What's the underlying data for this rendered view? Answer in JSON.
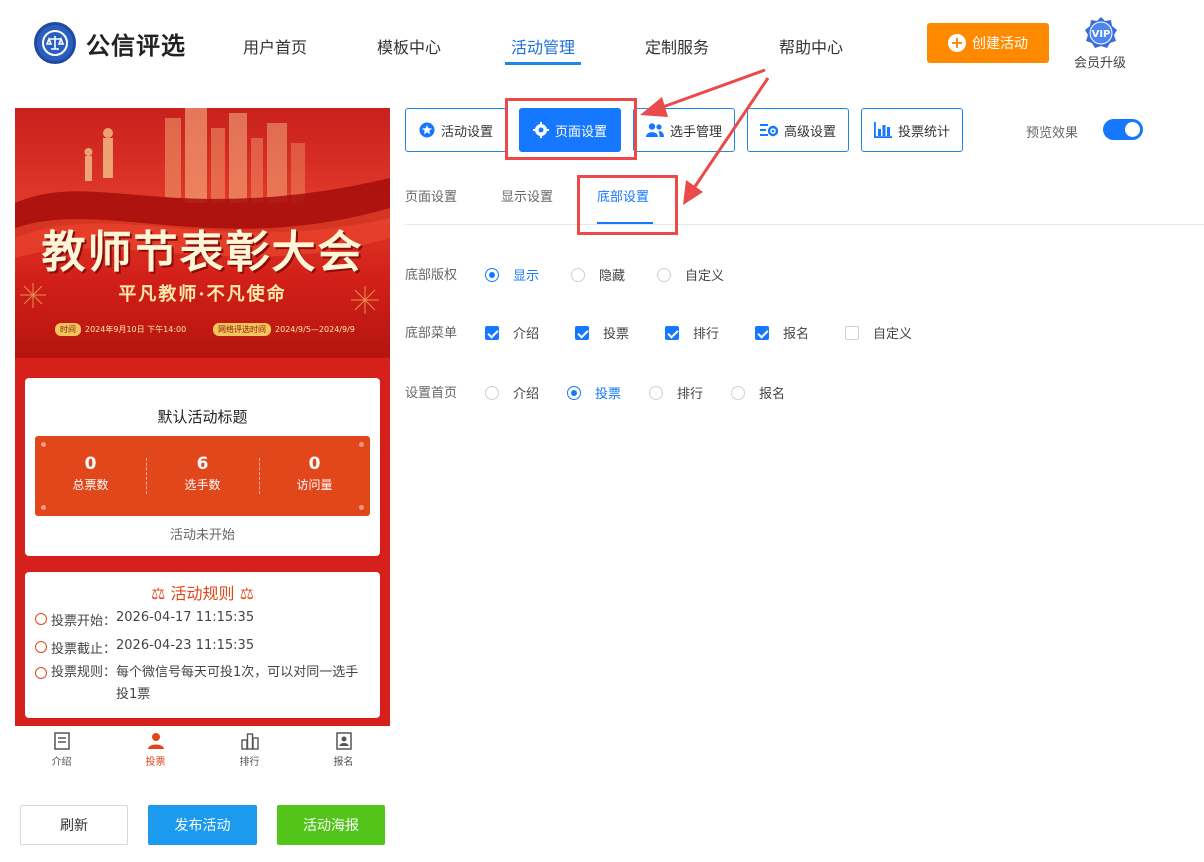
{
  "header": {
    "brand": "公信评选",
    "nav": [
      "用户首页",
      "模板中心",
      "活动管理",
      "定制服务",
      "帮助中心"
    ],
    "active_nav": "活动管理",
    "create_label": "创建活动",
    "vip_badge": "VIP",
    "vip_label": "会员升级"
  },
  "preview": {
    "banner_title": "教师节表彰大会",
    "banner_subtitle": "平凡教师·不凡使命",
    "banner_meta": [
      {
        "tag": "时间",
        "value": "2024年9月10日 下午14:00"
      },
      {
        "tag": "网络评选时间",
        "value": "2024/9/5—2024/9/9"
      }
    ],
    "activity_title": "默认活动标题",
    "stats": [
      {
        "value": "0",
        "label": "总票数"
      },
      {
        "value": "6",
        "label": "选手数"
      },
      {
        "value": "0",
        "label": "访问量"
      }
    ],
    "status": "活动未开始",
    "rules_title": "活动规则",
    "rules": [
      {
        "label": "投票开始：",
        "value": "2026-04-17 11:15:35"
      },
      {
        "label": "投票截止：",
        "value": "2026-04-23 11:15:35"
      },
      {
        "label": "投票规则：",
        "value": "每个微信号每天可投1次，可以对同一选手投1票"
      }
    ],
    "tabbar": [
      {
        "label": "介绍",
        "icon": "doc-icon"
      },
      {
        "label": "投票",
        "icon": "user-icon"
      },
      {
        "label": "排行",
        "icon": "bar-icon"
      },
      {
        "label": "报名",
        "icon": "badge-icon"
      }
    ],
    "active_tab": "投票"
  },
  "bottom_buttons": {
    "refresh": "刷新",
    "publish": "发布活动",
    "poster": "活动海报"
  },
  "settings": {
    "tools": [
      {
        "label": "活动设置",
        "icon": "star-icon"
      },
      {
        "label": "页面设置",
        "icon": "gear-icon"
      },
      {
        "label": "选手管理",
        "icon": "users-icon"
      },
      {
        "label": "高级设置",
        "icon": "sliders-icon"
      },
      {
        "label": "投票统计",
        "icon": "chart-icon"
      }
    ],
    "active_tool": "页面设置",
    "preview_label": "预览效果",
    "preview_on": true,
    "subtabs": [
      "页面设置",
      "显示设置",
      "底部设置"
    ],
    "active_subtab": "底部设置",
    "rows": [
      {
        "label": "底部版权",
        "type": "radio",
        "options": [
          {
            "label": "显示",
            "checked": true
          },
          {
            "label": "隐藏",
            "checked": false
          },
          {
            "label": "自定义",
            "checked": false
          }
        ]
      },
      {
        "label": "底部菜单",
        "type": "checkbox",
        "options": [
          {
            "label": "介绍",
            "checked": true
          },
          {
            "label": "投票",
            "checked": true
          },
          {
            "label": "排行",
            "checked": true
          },
          {
            "label": "报名",
            "checked": true
          },
          {
            "label": "自定义",
            "checked": false
          }
        ]
      },
      {
        "label": "设置首页",
        "type": "radio",
        "options": [
          {
            "label": "介绍",
            "checked": false
          },
          {
            "label": "投票",
            "checked": true
          },
          {
            "label": "排行",
            "checked": false
          },
          {
            "label": "报名",
            "checked": false
          }
        ]
      }
    ]
  },
  "colors": {
    "primary": "#1677ff",
    "accent_orange": "#ff8a00",
    "preview_red": "#d5201b",
    "stats_orange": "#e2471c",
    "publish_blue": "#1b9aee",
    "poster_green": "#52c41a",
    "annotation_red": "#ea4a4a"
  }
}
